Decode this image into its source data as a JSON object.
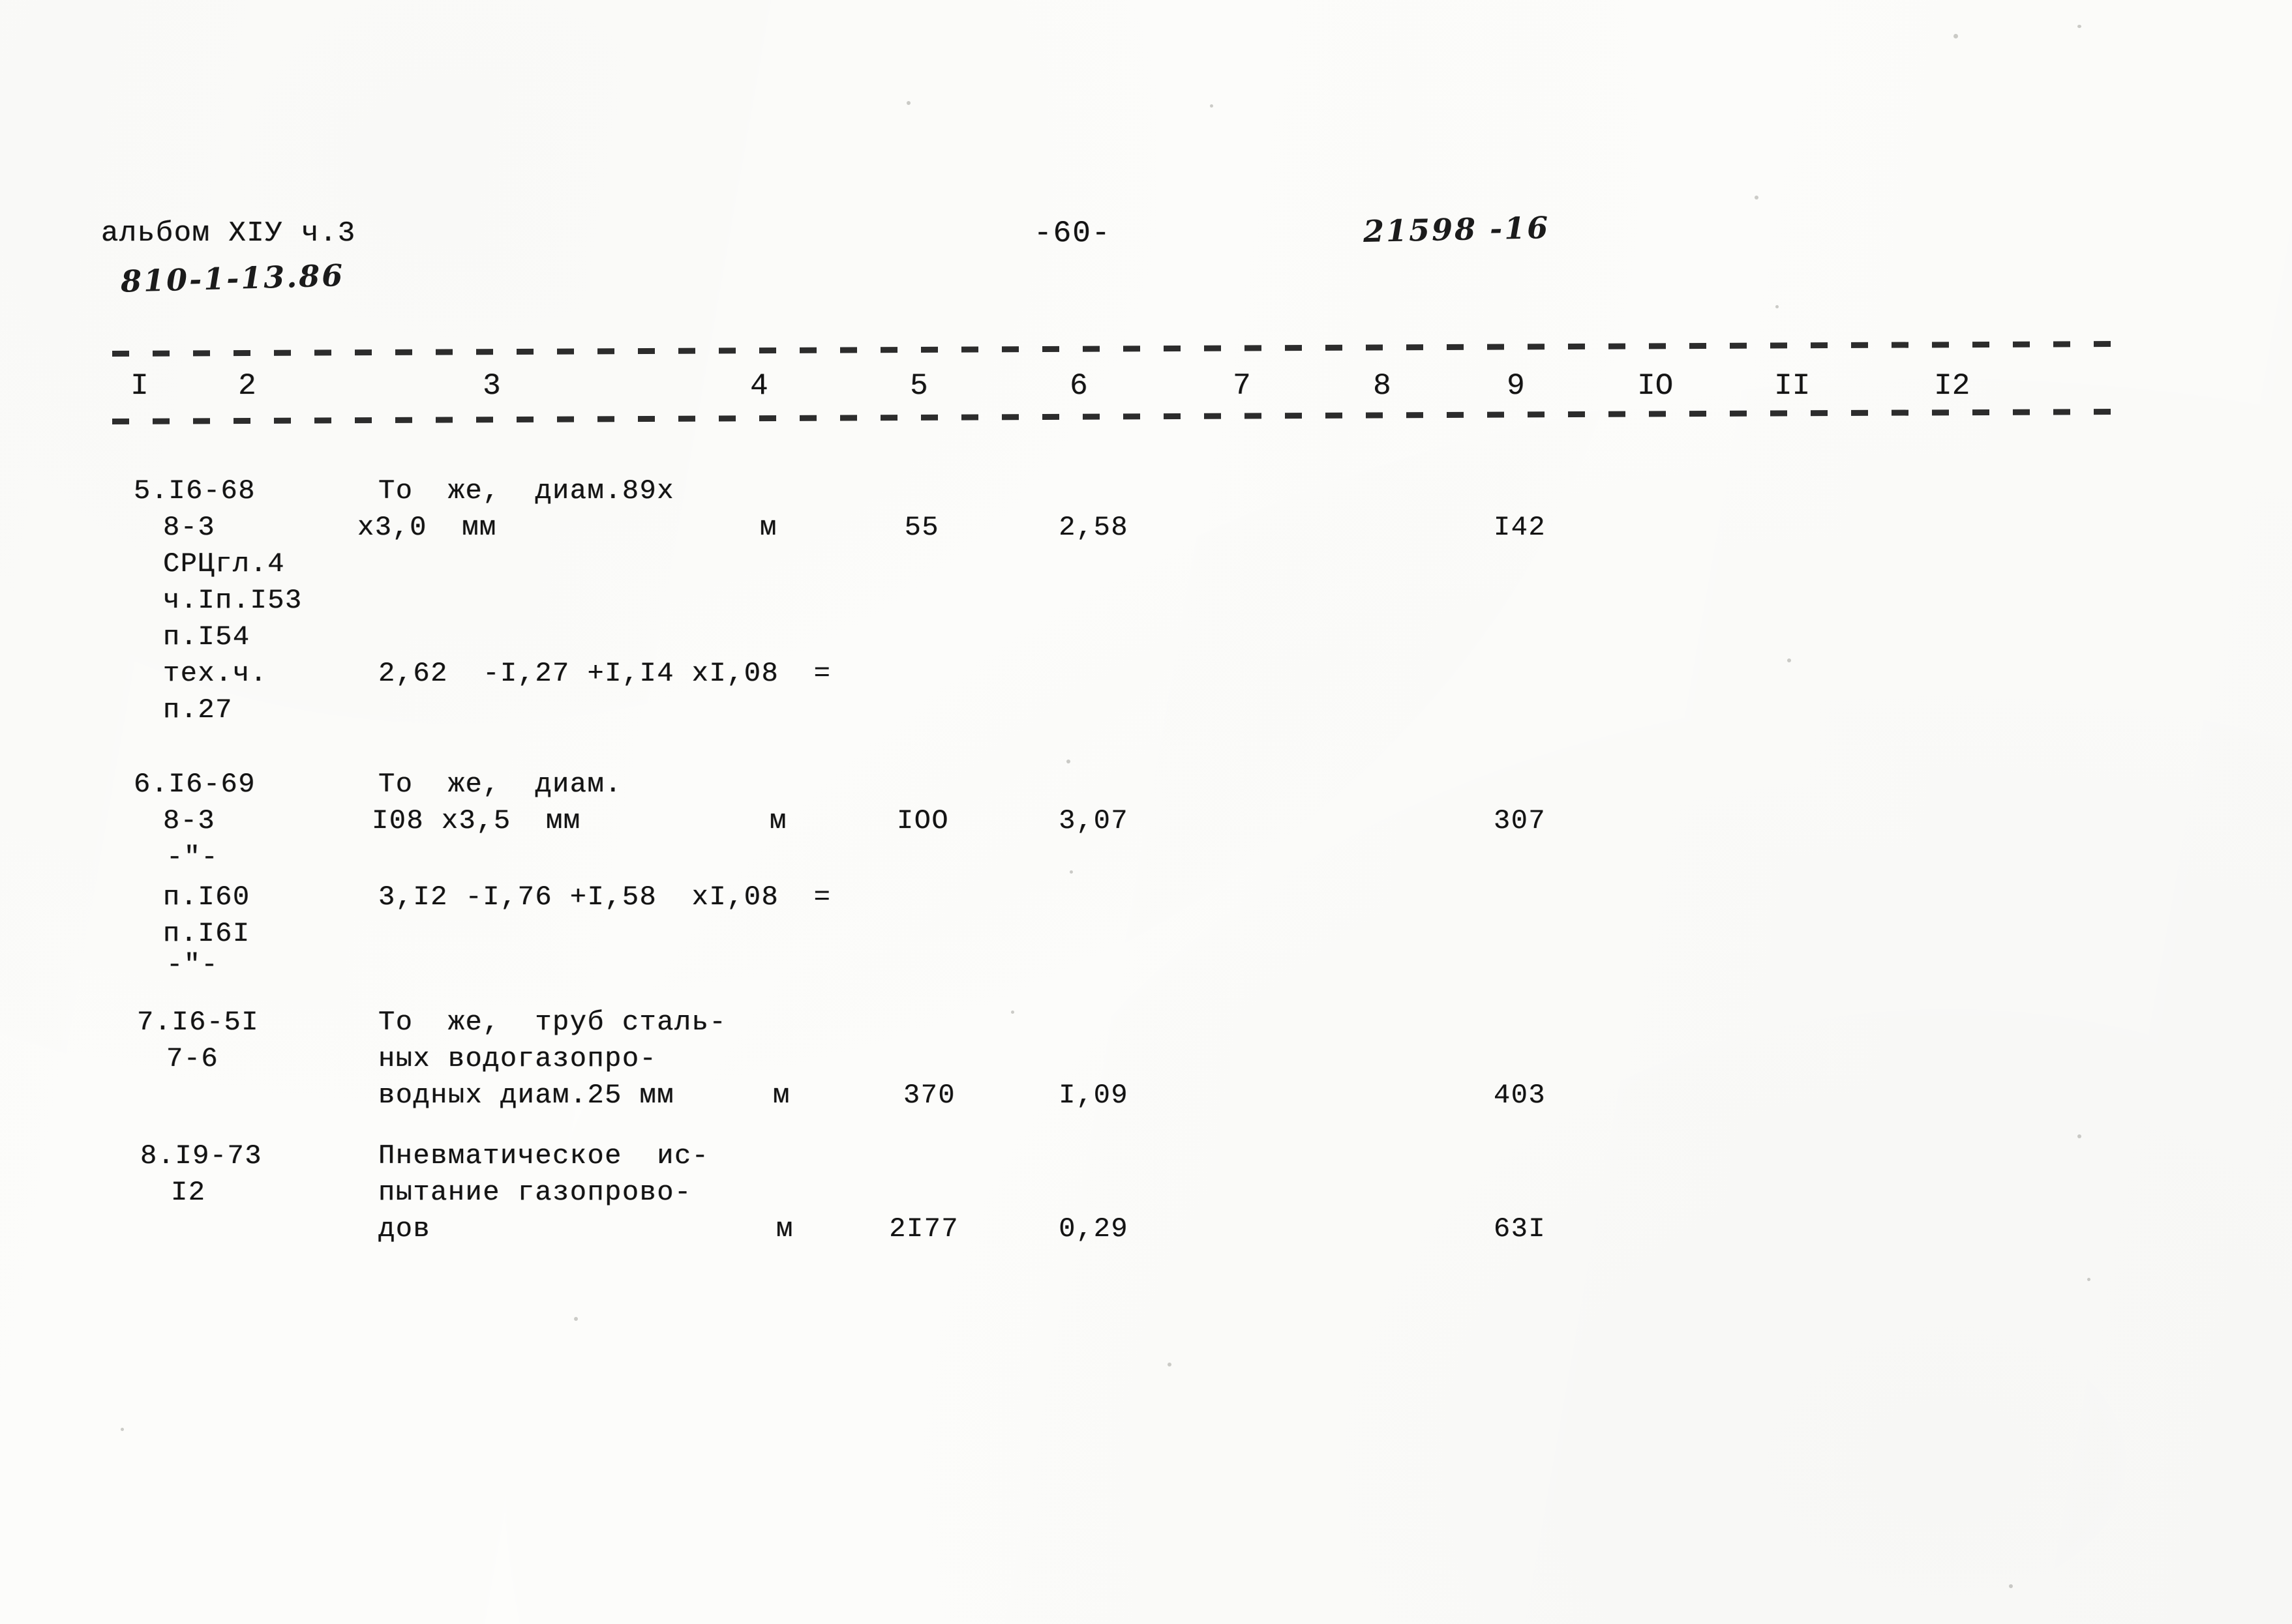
{
  "header": {
    "album_label": "альбом XIУ ч.3",
    "album_code_handwritten": "810-1-13.86",
    "page_number": "-60-",
    "doc_code_handwritten": "21598 -16"
  },
  "table": {
    "column_numbers": [
      "I",
      "2",
      "3",
      "4",
      "5",
      "6",
      "7",
      "8",
      "9",
      "IO",
      "II",
      "I2"
    ],
    "rows": [
      {
        "id": "row-5",
        "code_lines": [
          "5.I6-68",
          "8-3",
          "СРЦгл.4",
          "ч.Iп.I53",
          "п.I54",
          "тех.ч.",
          "п.27"
        ],
        "description_lines": [
          "То  же,  диам.89х",
          "х3,0  мм"
        ],
        "formula": "2,62  -I,27 +I,I4 хI,08  =",
        "unit": "м",
        "quantity": "55",
        "price": "2,58",
        "total": "I42"
      },
      {
        "id": "row-6",
        "code_lines": [
          "6.I6-69",
          "8-3",
          "-\"-",
          "п.I60",
          "п.I6I",
          "-\"-"
        ],
        "description_lines": [
          "То  же,  диам.",
          "I08 х3,5  мм"
        ],
        "formula": "3,I2 -I,76 +I,58  хI,08  =",
        "unit": "м",
        "quantity": "IOO",
        "price": "3,07",
        "total": "307"
      },
      {
        "id": "row-7",
        "code_lines": [
          "7.I6-5I",
          "7-6"
        ],
        "description_lines": [
          "То  же,  труб сталь-",
          "ных водогазопро-",
          "водных диам.25 мм"
        ],
        "formula": "",
        "unit": "м",
        "quantity": "370",
        "price": "I,09",
        "total": "403"
      },
      {
        "id": "row-8",
        "code_lines": [
          "8.I9-73",
          "I2"
        ],
        "description_lines": [
          "Пневматическое  ис-",
          "пытание газопрово-",
          "дов"
        ],
        "formula": "",
        "unit": "м",
        "quantity": "2I77",
        "price": "0,29",
        "total": "63I"
      }
    ]
  }
}
